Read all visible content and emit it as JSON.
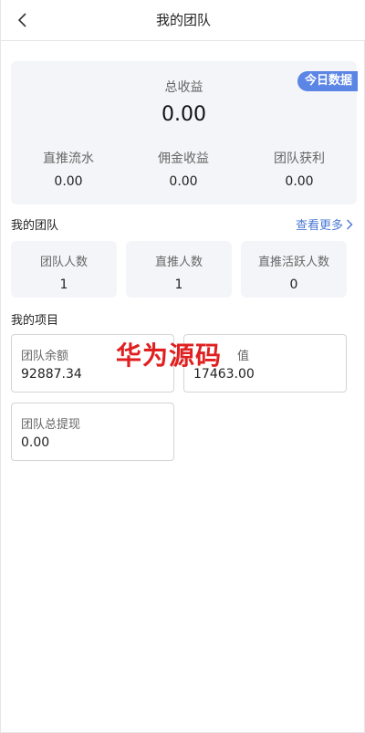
{
  "header": {
    "title": "我的团队",
    "back_icon": "chevron-left-icon"
  },
  "summary": {
    "badge": "今日数据",
    "total_label": "总收益",
    "total_value": "0.00",
    "stats": [
      {
        "label": "直推流水",
        "value": "0.00"
      },
      {
        "label": "佣金收益",
        "value": "0.00"
      },
      {
        "label": "团队获利",
        "value": "0.00"
      }
    ]
  },
  "team": {
    "title": "我的团队",
    "more_label": "查看更多",
    "items": [
      {
        "label": "团队人数",
        "value": "1"
      },
      {
        "label": "直推人数",
        "value": "1"
      },
      {
        "label": "直推活跃人数",
        "value": "0"
      }
    ]
  },
  "projects": {
    "title": "我的项目",
    "items": [
      {
        "label": "团队余额",
        "value": "92887.34"
      },
      {
        "label": "值",
        "value": "17463.00"
      },
      {
        "label": "团队总提现",
        "value": "0.00"
      }
    ]
  },
  "watermark": "华为源码",
  "colors": {
    "accent": "#5b86e5",
    "link": "#4a78d6",
    "watermark": "#e02020"
  }
}
